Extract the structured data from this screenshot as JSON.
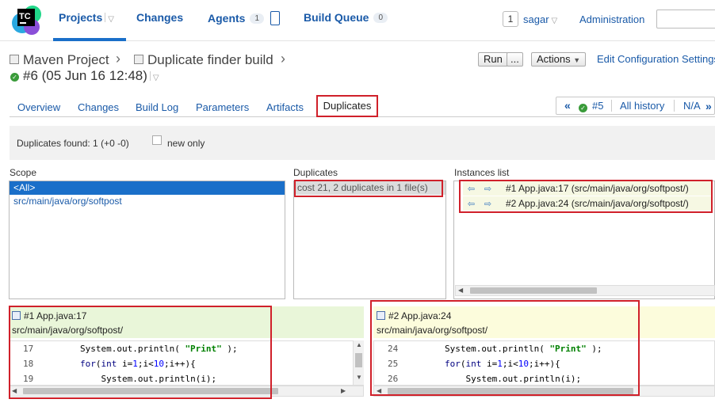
{
  "header": {
    "logo_text": "TC",
    "nav": {
      "projects": "Projects",
      "changes": "Changes",
      "agents": "Agents",
      "agents_count": "1",
      "build_queue": "Build Queue",
      "build_queue_count": "0"
    },
    "user_count": "1",
    "user_name": "sagar",
    "administration": "Administration"
  },
  "breadcrumb": {
    "project": "Maven Project",
    "build_config": "Duplicate finder build",
    "build": "#6 (05 Jun 16 12:48)"
  },
  "actions": {
    "run": "Run",
    "run_more": "...",
    "actions": "Actions",
    "edit_config": "Edit Configuration Settings"
  },
  "tabs": [
    "Overview",
    "Changes",
    "Build Log",
    "Parameters",
    "Artifacts",
    "Duplicates"
  ],
  "history": {
    "prev_build": "#5",
    "all_history": "All history",
    "next": "N/A"
  },
  "summary": {
    "text": "Duplicates found: 1 (+0 -0)",
    "new_only": "new only"
  },
  "scope": {
    "label": "Scope",
    "items": [
      "<All>",
      "src/main/java/org/softpost"
    ]
  },
  "duplicates": {
    "label": "Duplicates",
    "items": [
      "cost 21, 2 duplicates in 1 file(s)"
    ]
  },
  "instances": {
    "label": "Instances list",
    "items": [
      "#1 App.java:17 (src/main/java/org/softpost/)",
      "#2 App.java:24 (src/main/java/org/softpost/)"
    ]
  },
  "code_left": {
    "title": "#1 App.java:17",
    "path": "src/main/java/org/softpost/",
    "lines": [
      {
        "num": "17",
        "indent": "        ",
        "pre": "System.out.println( ",
        "str": "\"Print\"",
        "post": " );"
      },
      {
        "num": "18",
        "indent": "        ",
        "kw": "for",
        "rest_a": "(",
        "kw2": "int",
        "rest_b": " i=",
        "n1": "1",
        "rest_c": ";i<",
        "n2": "10",
        "rest_d": ";i++){"
      },
      {
        "num": "19",
        "indent": "            ",
        "pre": "System.out.println(i);"
      }
    ]
  },
  "code_right": {
    "title": "#2 App.java:24",
    "path": "src/main/java/org/softpost/",
    "lines": [
      {
        "num": "24",
        "indent": "        ",
        "pre": "System.out.println( ",
        "str": "\"Print\"",
        "post": " );"
      },
      {
        "num": "25",
        "indent": "        ",
        "kw": "for",
        "rest_a": "(",
        "kw2": "int",
        "rest_b": " i=",
        "n1": "1",
        "rest_c": ";i<",
        "n2": "10",
        "rest_d": ";i++){"
      },
      {
        "num": "26",
        "indent": "            ",
        "pre": "System.out.println(i);"
      }
    ]
  },
  "colors": {
    "accent": "#1a5aa8",
    "highlight_red": "#d0202a",
    "selection_blue": "#1a6fc9",
    "left_pane_bg": "#e9f6d9",
    "right_pane_bg": "#fcfcdc",
    "duplicate_row_bg": "#dcdcdc"
  }
}
